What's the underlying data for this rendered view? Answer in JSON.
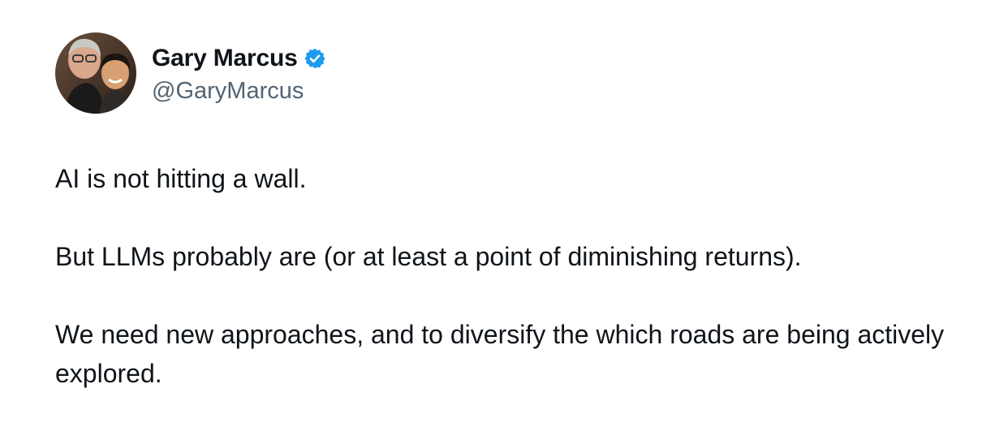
{
  "author": {
    "display_name": "Gary Marcus",
    "handle": "@GaryMarcus",
    "verified": true,
    "verified_color": "#1d9bf0",
    "avatar_icon": "profile-photo-avatar"
  },
  "tweet": {
    "paragraphs": [
      "AI is not hitting a wall.",
      "But LLMs probably are (or at least a point of diminishing returns).",
      "We need new approaches, and to diversify the which roads are being actively explored."
    ]
  }
}
